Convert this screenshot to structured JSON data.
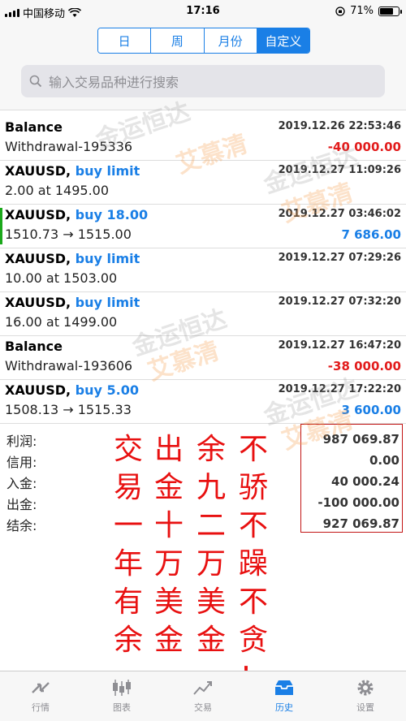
{
  "status": {
    "carrier": "中国移动",
    "time": "17:16",
    "battery_pct": "71%",
    "battery_level": 0.71
  },
  "segmented": {
    "items": [
      "日",
      "周",
      "月份",
      "自定义"
    ],
    "active_index": 3
  },
  "search": {
    "placeholder": "输入交易品种进行搜索"
  },
  "trades": [
    {
      "symbol": "Balance",
      "type": "",
      "detail": "Withdrawal-195336",
      "date": "2019.12.26 22:53:46",
      "amount": "-40 000.00",
      "amount_style": "neg"
    },
    {
      "symbol": "XAUUSD,",
      "type": "buy limit",
      "detail": "2.00 at 1495.00",
      "date": "2019.12.27 11:09:26",
      "amount": "",
      "amount_style": ""
    },
    {
      "symbol": "XAUUSD,",
      "type": "buy 18.00",
      "detail": "1510.73 → 1515.00",
      "date": "2019.12.27 03:46:02",
      "amount": "7 686.00",
      "amount_style": "pos"
    },
    {
      "symbol": "XAUUSD,",
      "type": "buy limit",
      "detail": "10.00 at 1503.00",
      "date": "2019.12.27 07:29:26",
      "amount": "",
      "amount_style": ""
    },
    {
      "symbol": "XAUUSD,",
      "type": "buy limit",
      "detail": "16.00 at 1499.00",
      "date": "2019.12.27 07:32:20",
      "amount": "",
      "amount_style": ""
    },
    {
      "symbol": "Balance",
      "type": "",
      "detail": "Withdrawal-193606",
      "date": "2019.12.27 16:47:20",
      "amount": "-38 000.00",
      "amount_style": "neg"
    },
    {
      "symbol": "XAUUSD,",
      "type": "buy 5.00",
      "detail": "1508.13 → 1515.33",
      "date": "2019.12.27 17:22:20",
      "amount": "3 600.00",
      "amount_style": "pos"
    }
  ],
  "summary": {
    "profit_label": "利润:",
    "profit": "987 069.87",
    "credit_label": "信用:",
    "credit": "0.00",
    "deposit_label": "入金:",
    "deposit": "40 000.24",
    "withdraw_label": "出金:",
    "withdraw": "-100 000.00",
    "balance_label": "结余:",
    "balance": "927 069.87"
  },
  "annotation": {
    "columns": [
      [
        "交",
        "易",
        "一",
        "年",
        "有",
        "余",
        "，"
      ],
      [
        "出",
        "金",
        "十",
        "万",
        "美",
        "金",
        "，"
      ],
      [
        "余",
        "九",
        "二",
        "万",
        "美",
        "金",
        "，"
      ],
      [
        "不",
        "骄",
        "不",
        "躁",
        "不",
        "贪",
        "！"
      ]
    ]
  },
  "watermark": {
    "line1": "金运恒达",
    "line2": "艾慕清"
  },
  "tabbar": {
    "items": [
      {
        "label": "行情",
        "icon": "quotes-icon"
      },
      {
        "label": "图表",
        "icon": "chart-icon"
      },
      {
        "label": "交易",
        "icon": "trade-icon"
      },
      {
        "label": "历史",
        "icon": "history-icon"
      },
      {
        "label": "设置",
        "icon": "settings-icon"
      }
    ],
    "active_index": 3
  },
  "colors": {
    "accent": "#1a7fe6",
    "negative": "#e21c1c",
    "annotation": "#e81010"
  }
}
